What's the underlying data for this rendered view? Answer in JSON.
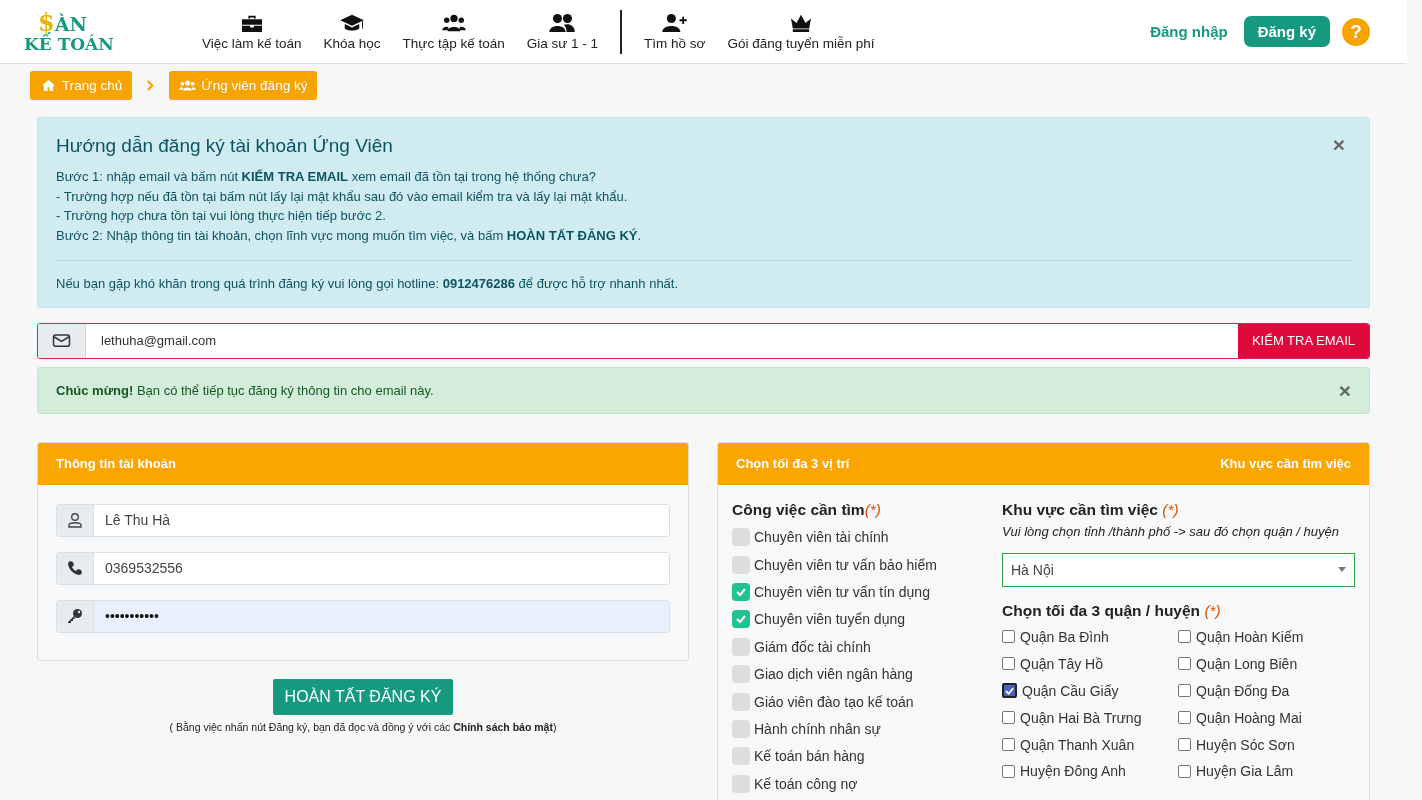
{
  "logo": {
    "mark": "$",
    "line1": "ÀN",
    "line2": "KẾ TOÁN"
  },
  "nav": [
    {
      "label": "Việc làm kế toán"
    },
    {
      "label": "Khóa học"
    },
    {
      "label": "Thực tập kế toán"
    },
    {
      "label": "Gia sư 1 - 1"
    },
    {
      "label": "Tìm hồ sơ"
    },
    {
      "label": "Gói đăng tuyển miễn phí"
    }
  ],
  "auth": {
    "login": "Đăng nhập",
    "register": "Đăng ký",
    "help": "?"
  },
  "breadcrumbs": [
    {
      "label": "Trang chủ"
    },
    {
      "label": "Ứng viên đăng ký"
    }
  ],
  "guide": {
    "title": "Hướng dẫn đăng ký tài khoản Ứng Viên",
    "close": "×",
    "lines": [
      "Bước 1: nhập email và bấm nút **KIỂM TRA EMAIL** xem email đã tồn tại trong hệ thống chưa?",
      "- Trường hợp nếu đã tồn tại bấm nút lấy lại mật khẩu sau đó vào email kiểm tra và lấy lại mật khẩu.",
      "- Trường hợp chưa tồn tại vui lòng thực hiện tiếp bước 2.",
      "Bước 2: Nhập thông tin tài khoản, chọn lĩnh vực mong muốn tìm việc, và bấm **HOÀN TẤT ĐĂNG KÝ**."
    ],
    "hotline": "Nếu bạn gặp khó khăn trong quá trình đăng ký vui lòng gọi hotline: **0912476286** để được hỗ trợ nhanh nhất."
  },
  "email": {
    "value": "lethuha@gmail.com",
    "button": "KIỂM TRA EMAIL"
  },
  "success": {
    "text": "**Chúc mừng!** Bạn có thể tiếp tục đăng ký thông tin cho email này.",
    "close": "×"
  },
  "account": {
    "title": "Thông tin tài khoản",
    "fields": [
      {
        "value": "Lê Thu Hà",
        "autofilled": false
      },
      {
        "value": "0369532556",
        "autofilled": false
      },
      {
        "value": "•••••••••••",
        "autofilled": true
      }
    ],
    "submit": "HOÀN TẤT ĐĂNG KÝ",
    "note": "( Bằng việc nhấn nút Đăng ký, bạn đã đọc và đồng ý với các **Chính sách bảo mật**)"
  },
  "positions": {
    "title_left": "Chọn tối đa 3 vị trí",
    "title_right": "Khu vực cần tìm việc",
    "jobs_heading": "Công việc cần tìm",
    "jobs_required": "(*)",
    "jobs": [
      {
        "label": "Chuyên viên tài chính",
        "checked": false
      },
      {
        "label": "Chuyên viên tư vấn bảo hiểm",
        "checked": false
      },
      {
        "label": "Chuyên viên tư vấn tín dụng",
        "checked": true
      },
      {
        "label": "Chuyên viên tuyển dụng",
        "checked": true
      },
      {
        "label": "Giám đốc tài chính",
        "checked": false
      },
      {
        "label": "Giao dịch viên ngân hàng",
        "checked": false
      },
      {
        "label": "Giáo viên đào tạo kế toán",
        "checked": false
      },
      {
        "label": "Hành chính nhân sự",
        "checked": false
      },
      {
        "label": "Kế toán bán hàng",
        "checked": false
      },
      {
        "label": "Kế toán công nợ",
        "checked": false
      }
    ],
    "area_heading": "Khu vực cần tìm việc",
    "area_required": "(*)",
    "area_hint": "Vui lòng chọn tỉnh /thành phố -> sau đó chọn quận / huyện",
    "city": "Hà Nội",
    "districts_heading": "Chọn tối đa 3 quận / huyện",
    "districts_required": "(*)",
    "districts": [
      {
        "label": "Quận Ba Đình",
        "checked": false
      },
      {
        "label": "Quận Hoàn Kiếm",
        "checked": false
      },
      {
        "label": "Quận Tây Hồ",
        "checked": false
      },
      {
        "label": "Quận Long Biên",
        "checked": false
      },
      {
        "label": "Quận Cầu Giấy",
        "checked": true
      },
      {
        "label": "Quận Đống Đa",
        "checked": false
      },
      {
        "label": "Quận Hai Bà Trưng",
        "checked": false
      },
      {
        "label": "Quận Hoàng Mai",
        "checked": false
      },
      {
        "label": "Quận Thanh Xuân",
        "checked": false
      },
      {
        "label": "Huyện Sóc Sơn",
        "checked": false
      },
      {
        "label": "Huyện Đông Anh",
        "checked": false
      },
      {
        "label": "Huyện Gia Lâm",
        "checked": false
      }
    ]
  }
}
